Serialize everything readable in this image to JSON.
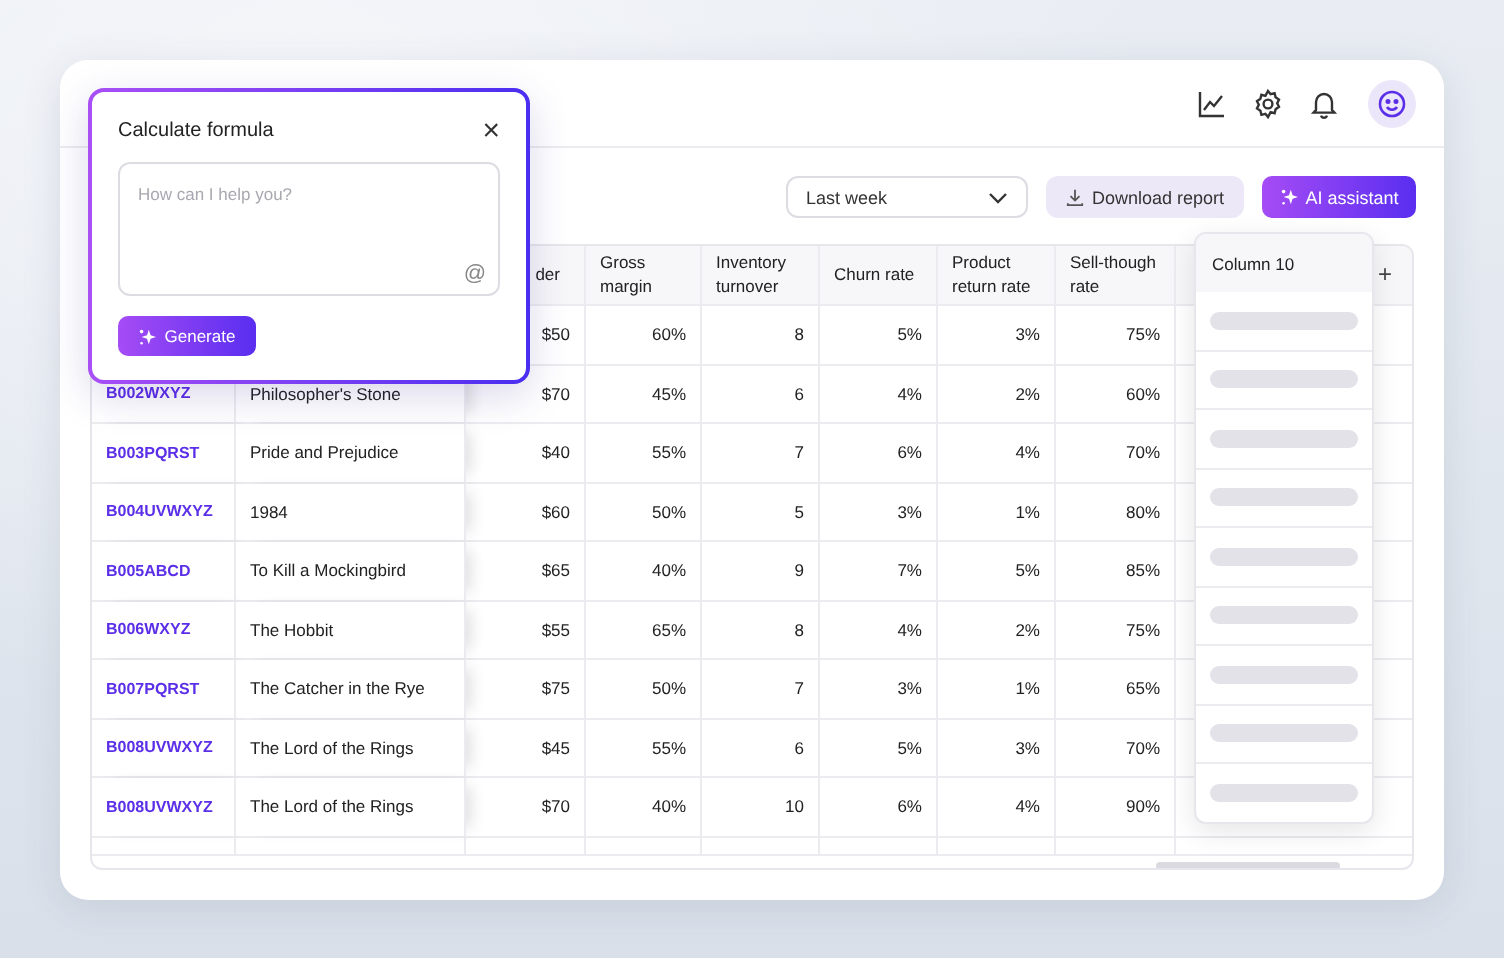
{
  "toolbar": {
    "period": "Last week",
    "download": "Download report",
    "assistant": "AI assistant"
  },
  "formula_popup": {
    "title": "Calculate formula",
    "close": "×",
    "placeholder": "How can I help you?",
    "mention": "@",
    "generate": "Generate"
  },
  "table": {
    "columns": [
      "der",
      "Gross margin",
      "Inventory turnover",
      "Churn rate",
      "Product return rate",
      "Sell-though rate"
    ],
    "add_column": "+",
    "new_column": "Column 10",
    "rows": [
      {
        "values": [
          "$50",
          "60%",
          "8",
          "5%",
          "3%",
          "75%"
        ]
      },
      {
        "asin": "B002WXYZ",
        "title": "Philosopher's Stone",
        "values": [
          "$70",
          "45%",
          "6",
          "4%",
          "2%",
          "60%"
        ]
      },
      {
        "asin": "B003PQRST",
        "title": "Pride and Prejudice",
        "values": [
          "$40",
          "55%",
          "7",
          "6%",
          "4%",
          "70%"
        ]
      },
      {
        "asin": "B004UVWXYZ",
        "title": "1984",
        "values": [
          "$60",
          "50%",
          "5",
          "3%",
          "1%",
          "80%"
        ]
      },
      {
        "asin": "B005ABCD",
        "title": "To Kill a Mockingbird",
        "values": [
          "$65",
          "40%",
          "9",
          "7%",
          "5%",
          "85%"
        ]
      },
      {
        "asin": "B006WXYZ",
        "title": "The Hobbit",
        "values": [
          "$55",
          "65%",
          "8",
          "4%",
          "2%",
          "75%"
        ]
      },
      {
        "asin": "B007PQRST",
        "title": "The Catcher in the Rye",
        "values": [
          "$75",
          "50%",
          "7",
          "3%",
          "1%",
          "65%"
        ]
      },
      {
        "asin": "B008UVWXYZ",
        "title": "The Lord of the Rings",
        "values": [
          "$45",
          "55%",
          "6",
          "5%",
          "3%",
          "70%"
        ]
      },
      {
        "asin": "B008UVWXYZ",
        "title": "The Lord of the Rings",
        "values": [
          "$70",
          "40%",
          "10",
          "6%",
          "4%",
          "90%"
        ]
      }
    ]
  }
}
